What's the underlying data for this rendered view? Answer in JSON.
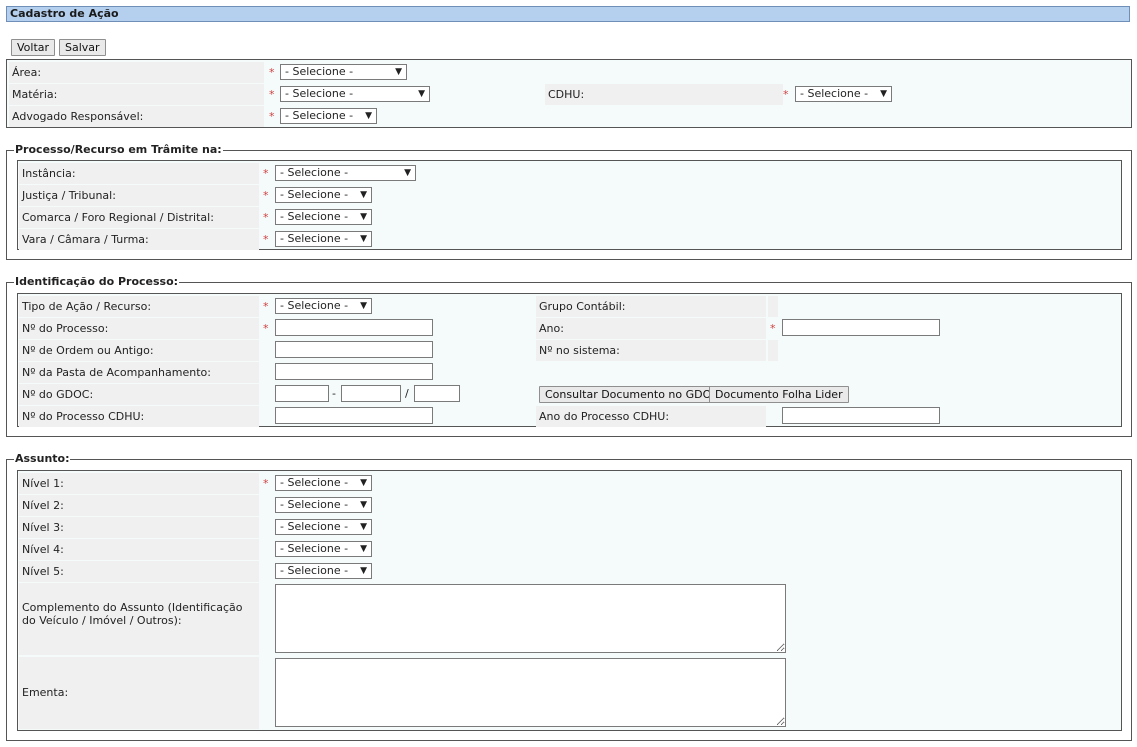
{
  "page": {
    "title": "Cadastro de Ação"
  },
  "toolbar": {
    "voltar": "Voltar",
    "salvar": "Salvar"
  },
  "select_default": "- Selecione -",
  "required_mark": "*",
  "top": {
    "area": "Área:",
    "materia": "Matéria:",
    "cdhu": "CDHU:",
    "advogado": "Advogado Responsável:"
  },
  "tramite": {
    "legend": "Processo/Recurso em Trâmite na:",
    "instancia": "Instância:",
    "justica": "Justiça / Tribunal:",
    "comarca": "Comarca / Foro Regional / Distrital:",
    "vara": "Vara / Câmara / Turma:"
  },
  "identificacao": {
    "legend": "Identificação do Processo:",
    "tipo": "Tipo de Ação / Recurso:",
    "grupo": "Grupo Contábil:",
    "num_processo": "Nº do Processo:",
    "ano": "Ano:",
    "num_ordem": "Nº de Ordem ou Antigo:",
    "num_sistema": "Nº no sistema:",
    "num_pasta": "Nº da Pasta de Acompanhamento:",
    "num_gdoc": "Nº do GDOC:",
    "gdoc_sep1": "-",
    "gdoc_sep2": "/",
    "consultar": "Consultar Documento no GDOC",
    "folha_lider": "Documento Folha Lider",
    "num_cdhu": "Nº do Processo CDHU:",
    "ano_cdhu": "Ano do Processo CDHU:"
  },
  "assunto": {
    "legend": "Assunto:",
    "nivel1": "Nível 1:",
    "nivel2": "Nível 2:",
    "nivel3": "Nível 3:",
    "nivel4": "Nível 4:",
    "nivel5": "Nível 5:",
    "complemento": "Complemento do Assunto (Identificação do Veículo / Imóvel / Outros):",
    "ementa": "Ementa:"
  }
}
